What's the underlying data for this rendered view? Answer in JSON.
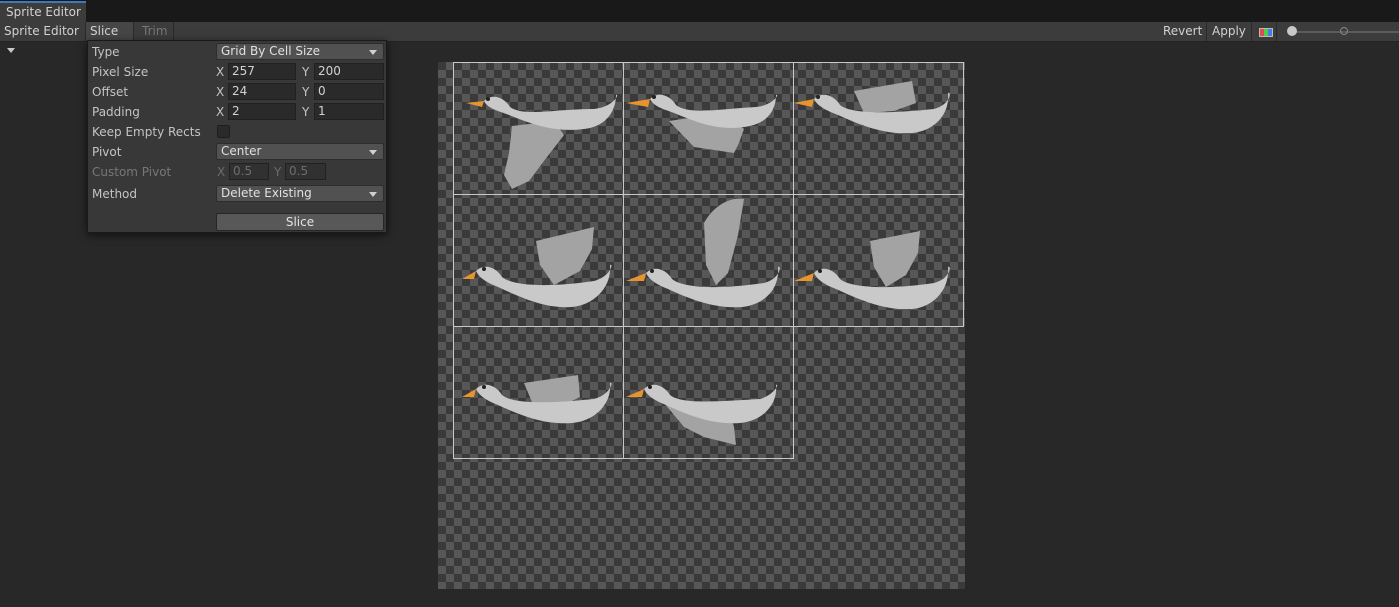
{
  "window": {
    "title": "Sprite Editor"
  },
  "toolbar": {
    "mode_label": "Sprite Editor",
    "slice_label": "Slice",
    "trim_label": "Trim",
    "revert_label": "Revert",
    "apply_label": "Apply",
    "color_icon": "color-channel-icon"
  },
  "slice_panel": {
    "type_label": "Type",
    "type_value": "Grid By Cell Size",
    "pixel_size_label": "Pixel Size",
    "pixel_size": {
      "x": "257",
      "y": "200"
    },
    "offset_label": "Offset",
    "offset": {
      "x": "24",
      "y": "0"
    },
    "padding_label": "Padding",
    "padding": {
      "x": "2",
      "y": "1"
    },
    "keep_empty_label": "Keep Empty Rects",
    "keep_empty_checked": false,
    "pivot_label": "Pivot",
    "pivot_value": "Center",
    "custom_pivot_label": "Custom Pivot",
    "custom_pivot": {
      "x": "0.5",
      "y": "0.5"
    },
    "method_label": "Method",
    "method_value": "Delete Existing",
    "slice_button": "Slice",
    "axis_x": "X",
    "axis_y": "Y"
  },
  "canvas": {
    "sprite_count": 8,
    "colors": {
      "body": "#c9c9c9",
      "wing": "#a3a3a3",
      "beak": "#e8942e",
      "outline": "#c8c8c8"
    }
  }
}
